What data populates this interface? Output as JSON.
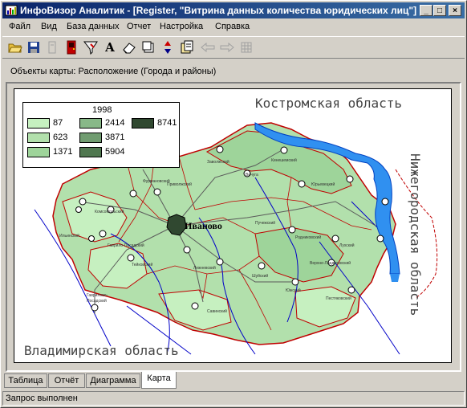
{
  "window": {
    "title": "ИнфоВизор Аналитик - [Register, \"Витрина данных количества юридических лиц\"]",
    "controls": {
      "minimize": "_",
      "maximize": "□",
      "close": "×"
    }
  },
  "menu": [
    "Файл",
    "Вид",
    "База данных",
    "Отчет",
    "Настройка",
    "Справка"
  ],
  "toolbar": {
    "icons": [
      "open-folder-icon",
      "save-icon",
      "doc-disabled-icon",
      "exit-icon",
      "filter-icon",
      "font-icon",
      "eraser-icon",
      "window-icon",
      "sort-icon",
      "export-icon",
      "back-arrow-icon",
      "forward-arrow-icon",
      "grid-disabled-icon"
    ]
  },
  "objects_label": "Объекты карты: Расположение (Города и районы)",
  "map": {
    "legend": {
      "title": "1998",
      "items": [
        {
          "label": "87",
          "color": "#c6f0c0"
        },
        {
          "label": "623",
          "color": "#b2e0ac"
        },
        {
          "label": "1371",
          "color": "#9ed49a"
        },
        {
          "label": "2414",
          "color": "#88b888"
        },
        {
          "label": "3871",
          "color": "#709c70"
        },
        {
          "label": "5904",
          "color": "#507850"
        },
        {
          "label": "8741",
          "color": "#304830"
        }
      ]
    },
    "neighbors": {
      "north": "Костромская область",
      "east": "Нижегородская область",
      "south": "Владимирская область"
    },
    "capital": "Иваново"
  },
  "tabs": [
    {
      "label": "Таблица",
      "active": false
    },
    {
      "label": "Отчёт",
      "active": false
    },
    {
      "label": "Диаграмма",
      "active": false
    },
    {
      "label": "Карта",
      "active": true
    }
  ],
  "status": "Запрос выполнен"
}
